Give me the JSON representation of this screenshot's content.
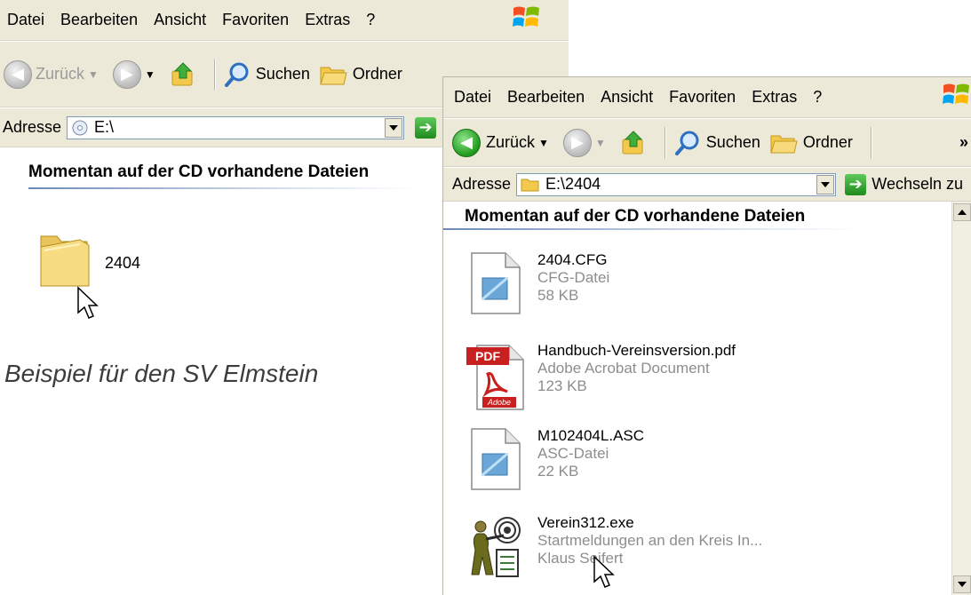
{
  "window_back": {
    "menu": [
      "Datei",
      "Bearbeiten",
      "Ansicht",
      "Favoriten",
      "Extras",
      "?"
    ],
    "toolbar": {
      "back_label": "Zurück",
      "search_label": "Suchen",
      "folders_label": "Ordner"
    },
    "address": {
      "label": "Adresse",
      "value": "E:\\"
    },
    "heading": "Momentan auf der CD vorhandene Dateien",
    "items": [
      {
        "name": "2404",
        "icon": "folder-icon"
      }
    ]
  },
  "window_front": {
    "menu": [
      "Datei",
      "Bearbeiten",
      "Ansicht",
      "Favoriten",
      "Extras",
      "?"
    ],
    "toolbar": {
      "back_label": "Zurück",
      "search_label": "Suchen",
      "folders_label": "Ordner",
      "overflow": "»"
    },
    "address": {
      "label": "Adresse",
      "value": "E:\\2404",
      "go_label": "Wechseln zu"
    },
    "heading": "Momentan auf der CD vorhandene Dateien",
    "files": [
      {
        "name": "2404.CFG",
        "type": "CFG-Datei",
        "info": "58 KB",
        "icon": "generic-file-icon"
      },
      {
        "name": "Handbuch-Vereinsversion.pdf",
        "type": "Adobe Acrobat Document",
        "info": "123 KB",
        "icon": "pdf-file-icon",
        "badge": "PDF",
        "brand": "Adobe"
      },
      {
        "name": "M102404L.ASC",
        "type": "ASC-Datei",
        "info": "22 KB",
        "icon": "generic-file-icon"
      },
      {
        "name": "Verein312.exe",
        "type": "Startmeldungen an den Kreis In...",
        "info": "Klaus Seifert",
        "icon": "shooter-exe-icon"
      }
    ]
  },
  "caption": "Beispiel für den SV Elmstein"
}
